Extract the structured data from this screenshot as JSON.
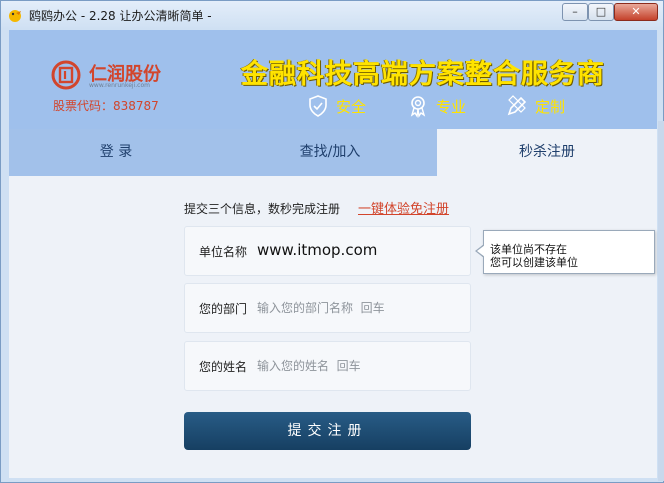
{
  "window": {
    "title": "鸥鸥办公 - 2.28 让办公清晰简单 -",
    "minimize_glyph": "–",
    "maximize_glyph": "□",
    "close_glyph": "✕"
  },
  "banner": {
    "company_name": "仁润股份",
    "company_url": "www.renrunkeji.com",
    "stock_code": "股票代码：838787",
    "slogan": "金融科技高端方案整合服务商",
    "features": [
      "安全",
      "专业",
      "定制"
    ]
  },
  "tabs": [
    {
      "label": "登 录"
    },
    {
      "label": "查找/加入"
    },
    {
      "label": "秒杀注册",
      "active": true
    }
  ],
  "form": {
    "info_text": "提交三个信息，数秒完成注册",
    "quick_link": "一键体验免注册",
    "unit_label": "单位名称",
    "unit_value": "www.itmop.com",
    "dept_label": "您的部门",
    "dept_placeholder": "输入您的部门名称  回车",
    "name_label": "您的姓名",
    "name_placeholder": "输入您的姓名  回车",
    "submit_label": "提交注册"
  },
  "tooltip": {
    "line1": "该单位尚不存在",
    "line2": "您可以创建该单位"
  },
  "colors": {
    "brand_red": "#d2452c",
    "slogan_yellow": "#ffe300",
    "banner_blue": "#9fc0ec",
    "submit_navy": "#1d4a72"
  }
}
